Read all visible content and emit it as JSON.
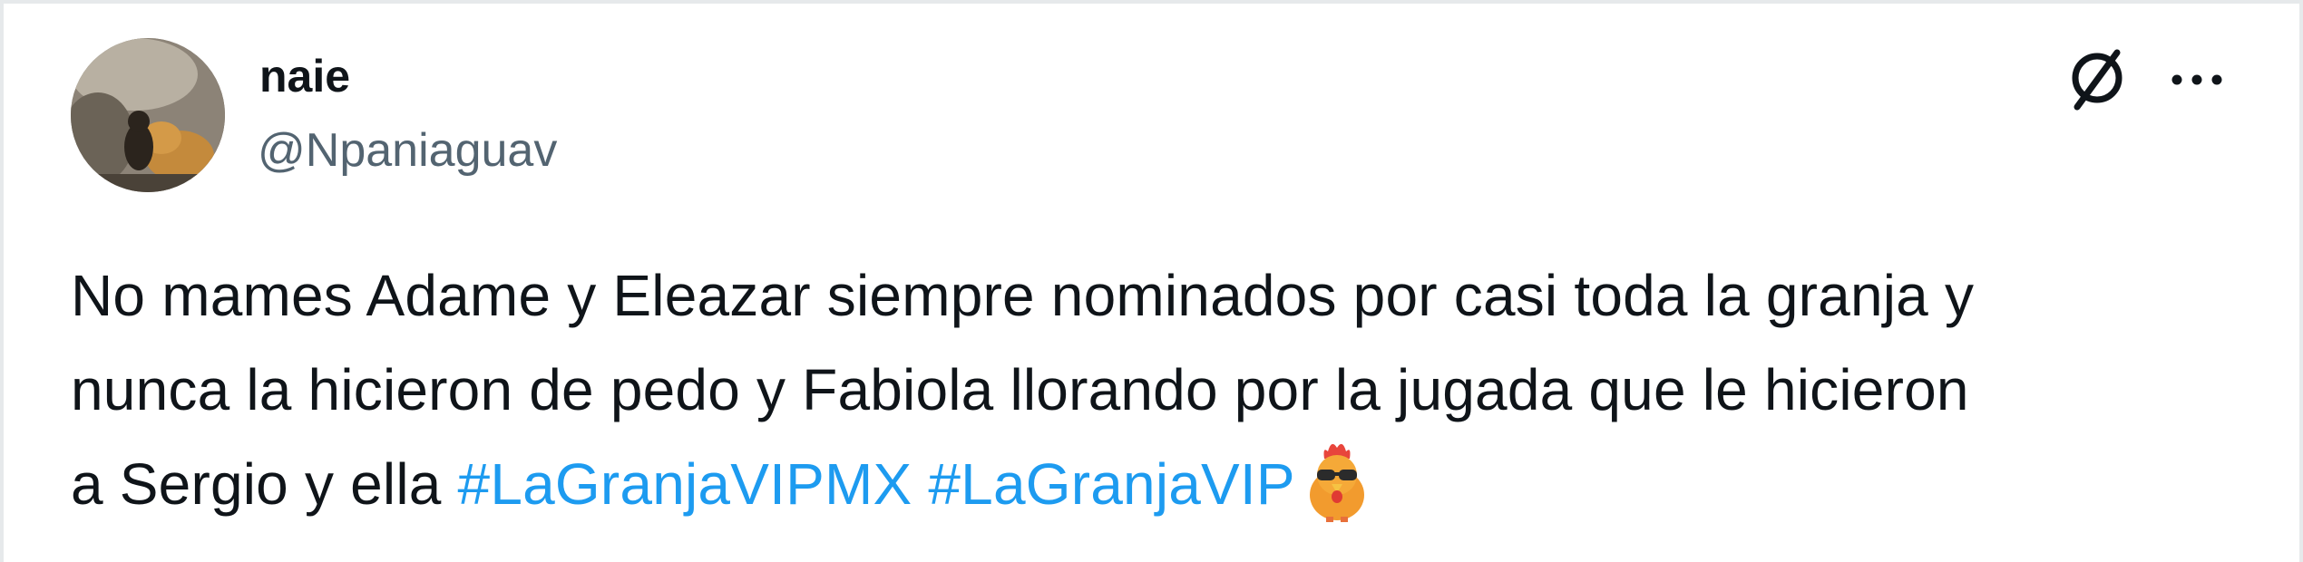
{
  "author": {
    "display_name": "naie",
    "handle": "@Npaniaguav",
    "avatar": "profile-photo"
  },
  "actions": {
    "grok_icon": "grok-slash-icon",
    "more_icon": "more-dots-icon",
    "more_glyph": "···"
  },
  "tweet": {
    "text_part1": "No mames Adame y Eleazar siempre nominados por casi toda la granja y\nnunca la hicieron de pedo y Fabiola llorando por la jugada que le hicieron\na Sergio y ella ",
    "hashtag1": "#LaGranjaVIPMX",
    "spacer": " ",
    "hashtag2": "#LaGranjaVIP",
    "emoji": "rooster-with-sunglasses-emoji"
  },
  "colors": {
    "text": "#0f1419",
    "secondary": "#536471",
    "link": "#1d9bf0",
    "border": "#e6e9eb"
  }
}
